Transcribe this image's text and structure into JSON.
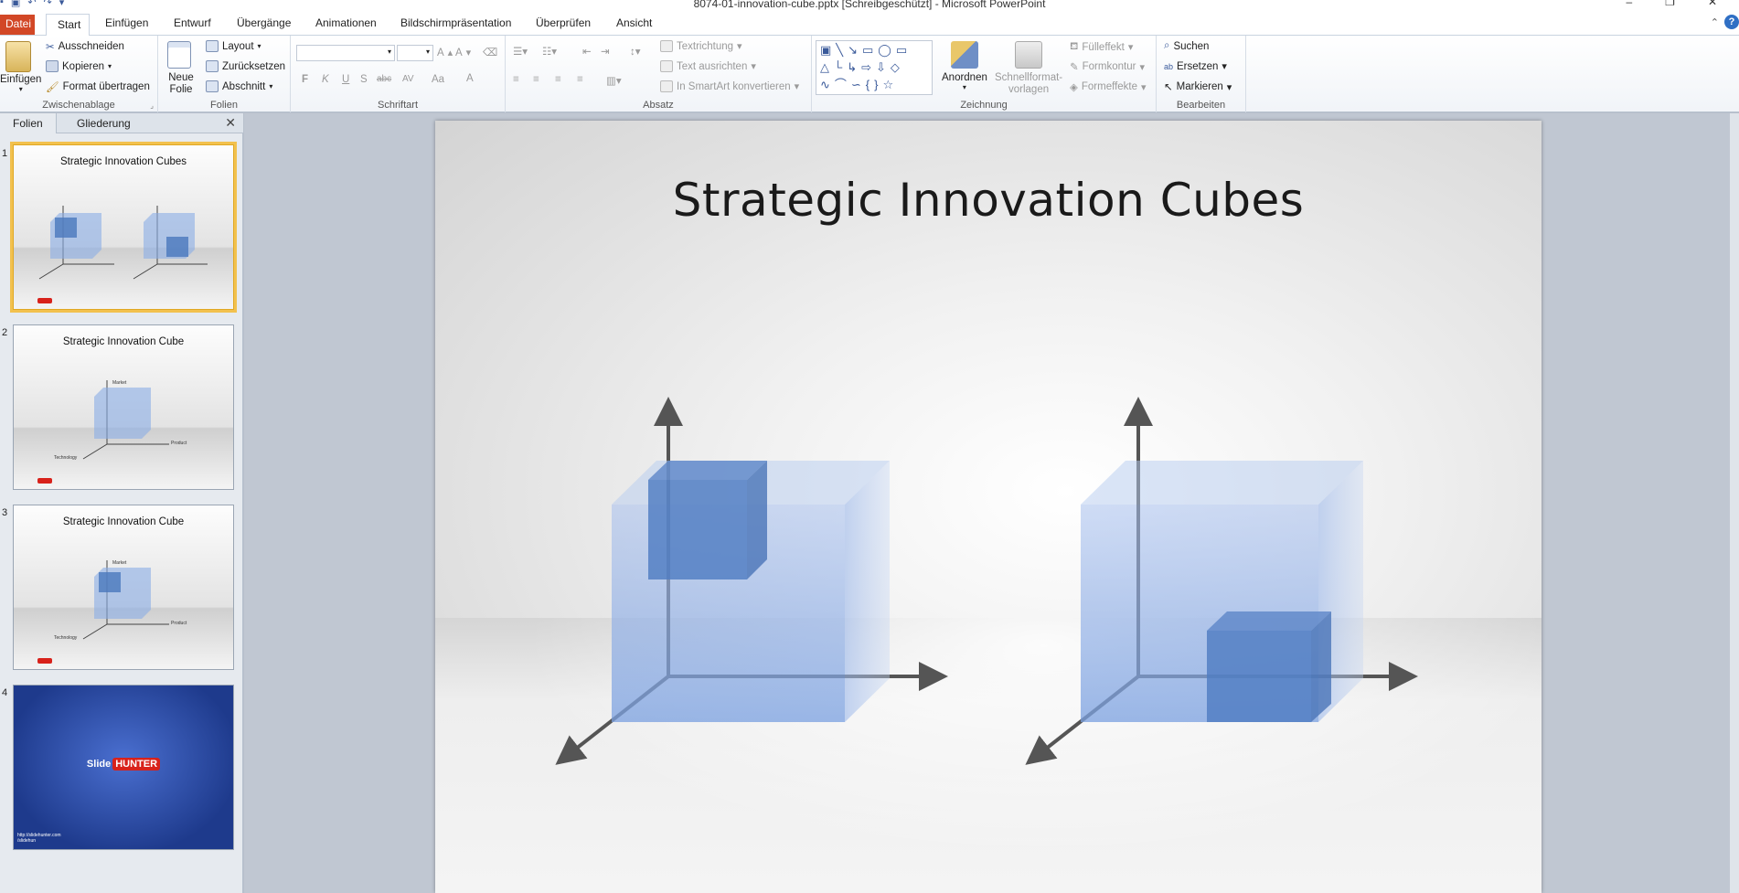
{
  "window": {
    "title": "8074-01-innovation-cube.pptx [Schreibgeschützt] - Microsoft PowerPoint"
  },
  "tabs": {
    "file": "Datei",
    "items": [
      "Start",
      "Einfügen",
      "Entwurf",
      "Übergänge",
      "Animationen",
      "Bildschirmpräsentation",
      "Überprüfen",
      "Ansicht"
    ]
  },
  "ribbon": {
    "clipboard": {
      "paste": "Einfügen",
      "cut": "Ausschneiden",
      "copy": "Kopieren",
      "format_painter": "Format übertragen",
      "label": "Zwischenablage"
    },
    "slides": {
      "new_slide": "Neue Folie",
      "layout": "Layout",
      "reset": "Zurücksetzen",
      "section": "Abschnitt",
      "label": "Folien"
    },
    "font": {
      "bold": "F",
      "italic": "K",
      "underline": "U",
      "shadow": "S",
      "strike": "abc",
      "spacing": "AV",
      "case": "Aa",
      "color": "A",
      "grow": "A",
      "shrink": "A",
      "label": "Schriftart"
    },
    "paragraph": {
      "text_direction": "Textrichtung",
      "align_text": "Text ausrichten",
      "smartart": "In SmartArt konvertieren",
      "label": "Absatz"
    },
    "drawing": {
      "arrange": "Anordnen",
      "quick_styles_1": "Schnellformat-",
      "quick_styles_2": "vorlagen",
      "fill": "Fülleffekt",
      "outline": "Formkontur",
      "effects": "Formeffekte",
      "label": "Zeichnung"
    },
    "editing": {
      "find": "Suchen",
      "replace": "Ersetzen",
      "select": "Markieren",
      "label": "Bearbeiten"
    }
  },
  "pane": {
    "tab_slides": "Folien",
    "tab_outline": "Gliederung",
    "close": "✕"
  },
  "thumbnails": [
    {
      "num": "1",
      "title": "Strategic Innovation Cubes"
    },
    {
      "num": "2",
      "title": "Strategic Innovation Cube",
      "labels": [
        "Market",
        "Product",
        "Technology"
      ]
    },
    {
      "num": "3",
      "title": "Strategic Innovation Cube",
      "labels": [
        "Market",
        "Product",
        "Technology"
      ]
    },
    {
      "num": "4",
      "brand": "Slide",
      "brand_badge": "HUNTER",
      "links": [
        "http://slidehunter.com",
        "/slidehun"
      ]
    }
  ],
  "slide": {
    "title": "Strategic Innovation Cubes"
  },
  "colors": {
    "file_tab": "#d24726",
    "cube_fill": "#8aaee6",
    "cube_small": "#4a78bd",
    "axis": "#555555",
    "selection": "#f2c14e"
  }
}
